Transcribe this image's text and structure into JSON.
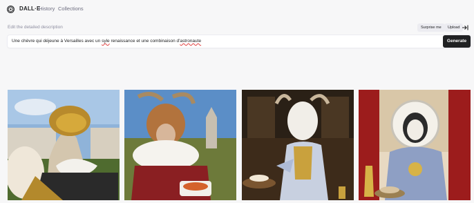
{
  "app": {
    "brand": "DALL·E",
    "nav": [
      "History",
      "Collections"
    ]
  },
  "editor": {
    "label": "Edit the detailed description",
    "surprise_label": "Surprise me",
    "upload_label": "Upload",
    "prompt_before": "Une chèvre qui déjeune à Versailles avec un ",
    "prompt_misspelled": "syle",
    "prompt_middle": " renaissance et une combinaison d'",
    "prompt_misspelled2": "astronaute",
    "generate_label": "Generate"
  },
  "results": [
    {
      "subject": "goat in gold helmet and ruff"
    },
    {
      "subject": "goat with white ruff collar eating"
    },
    {
      "subject": "goat in gilded gown"
    },
    {
      "subject": "goat in astronaut helmet and renaissance armor"
    }
  ],
  "colors": {
    "background": "#f7f7f8",
    "button_dark": "#202123",
    "pill_gray": "#ececf1",
    "muted_text": "#8e8ea0"
  }
}
